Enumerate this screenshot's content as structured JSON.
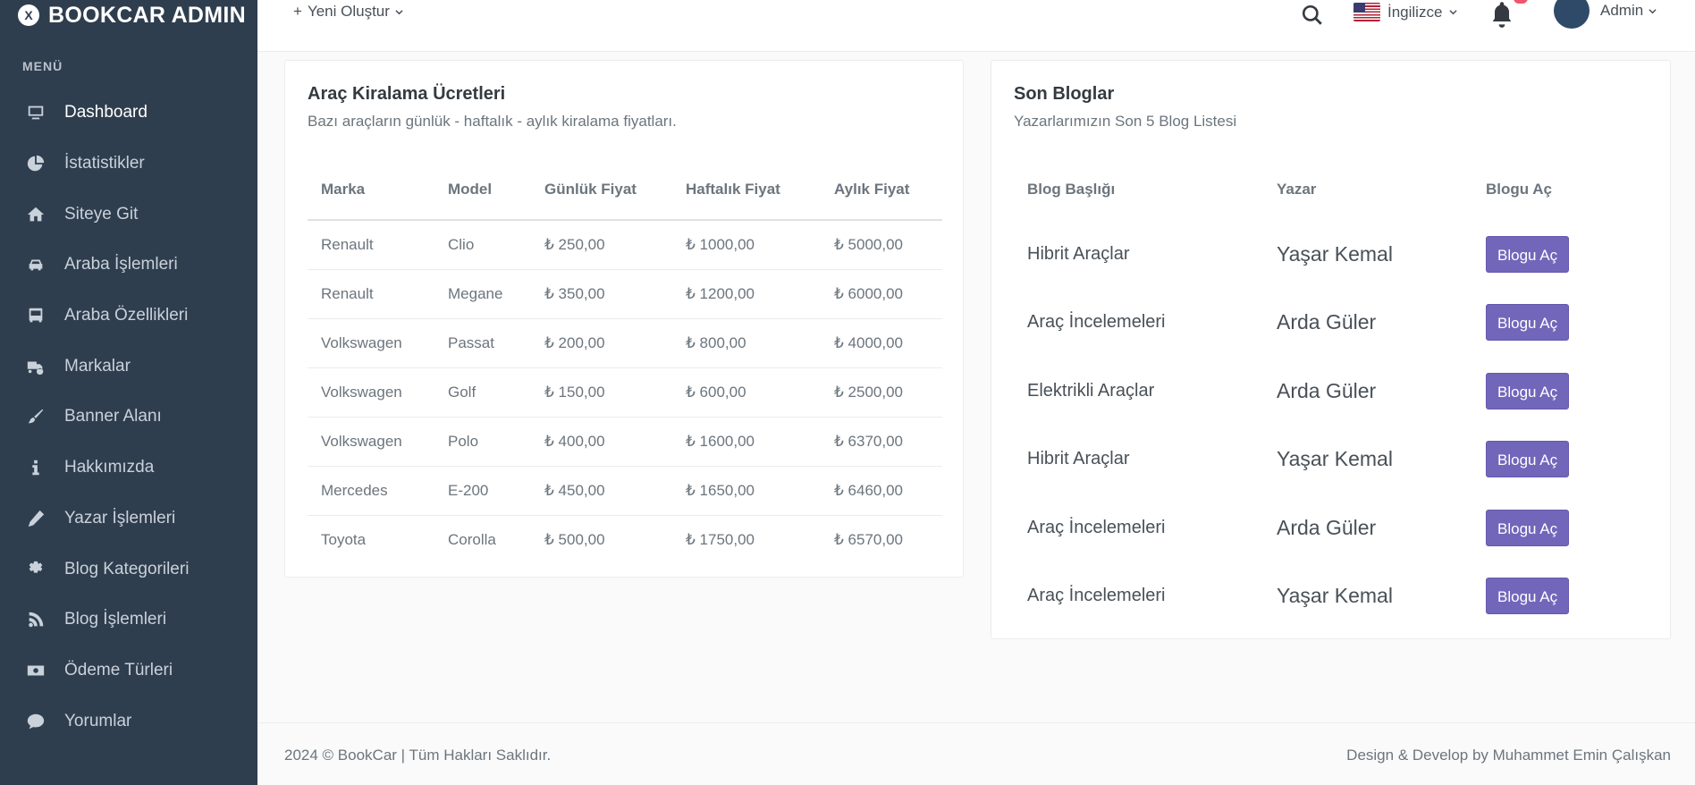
{
  "brand": {
    "logo_letter": "X",
    "name": "BOOKCAR ADMIN"
  },
  "sidebar": {
    "menu_title": "MENÜ",
    "items": [
      {
        "label": "Dashboard",
        "icon": "monitor-icon"
      },
      {
        "label": "İstatistikler",
        "icon": "pie-chart-icon"
      },
      {
        "label": "Siteye Git",
        "icon": "home-icon"
      },
      {
        "label": "Araba İşlemleri",
        "icon": "car-icon"
      },
      {
        "label": "Araba Özellikleri",
        "icon": "bus-icon"
      },
      {
        "label": "Markalar",
        "icon": "truck-gear-icon"
      },
      {
        "label": "Banner Alanı",
        "icon": "brush-icon"
      },
      {
        "label": "Hakkımızda",
        "icon": "info-icon"
      },
      {
        "label": "Yazar İşlemleri",
        "icon": "pencil-icon"
      },
      {
        "label": "Blog Kategorileri",
        "icon": "gear-icon"
      },
      {
        "label": "Blog İşlemleri",
        "icon": "blog-icon"
      },
      {
        "label": "Ödeme Türleri",
        "icon": "money-icon"
      },
      {
        "label": "Yorumlar",
        "icon": "comment-icon"
      }
    ]
  },
  "topbar": {
    "create_new": "Yeni Oluştur",
    "language": "İngilizce",
    "user": "Admin"
  },
  "prices": {
    "title": "Araç Kiralama Ücretleri",
    "subtitle": "Bazı araçların günlük - haftalık - aylık kiralama fiyatları.",
    "headers": [
      "Marka",
      "Model",
      "Günlük Fiyat",
      "Haftalık Fiyat",
      "Aylık Fiyat"
    ],
    "rows": [
      [
        "Renault",
        "Clio",
        "₺ 250,00",
        "₺ 1000,00",
        "₺ 5000,00"
      ],
      [
        "Renault",
        "Megane",
        "₺ 350,00",
        "₺ 1200,00",
        "₺ 6000,00"
      ],
      [
        "Volkswagen",
        "Passat",
        "₺ 200,00",
        "₺ 800,00",
        "₺ 4000,00"
      ],
      [
        "Volkswagen",
        "Golf",
        "₺ 150,00",
        "₺ 600,00",
        "₺ 2500,00"
      ],
      [
        "Volkswagen",
        "Polo",
        "₺ 400,00",
        "₺ 1600,00",
        "₺ 6370,00"
      ],
      [
        "Mercedes",
        "E-200",
        "₺ 450,00",
        "₺ 1650,00",
        "₺ 6460,00"
      ],
      [
        "Toyota",
        "Corolla",
        "₺ 500,00",
        "₺ 1750,00",
        "₺ 6570,00"
      ]
    ]
  },
  "blogs": {
    "title": "Son Bloglar",
    "subtitle": "Yazarlarımızın Son 5 Blog Listesi",
    "headers": [
      "Blog Başlığı",
      "Yazar",
      "Blogu Aç"
    ],
    "button_label": "Blogu Aç",
    "rows": [
      [
        "Hibrit Araçlar",
        "Yaşar Kemal"
      ],
      [
        "Araç İncelemeleri",
        "Arda Güler"
      ],
      [
        "Elektrikli Araçlar",
        "Arda Güler"
      ],
      [
        "Hibrit Araçlar",
        "Yaşar Kemal"
      ],
      [
        "Araç İncelemeleri",
        "Arda Güler"
      ],
      [
        "Araç İncelemeleri",
        "Yaşar Kemal"
      ]
    ]
  },
  "footer": {
    "left": "2024 © BookCar | Tüm Hakları Saklıdır.",
    "right": "Design & Develop by Muhammet Emin Çalışkan"
  },
  "colors": {
    "sidebar_bg": "#2f3e4e",
    "button_bg": "#7266ba",
    "badge": "#f1556c"
  }
}
